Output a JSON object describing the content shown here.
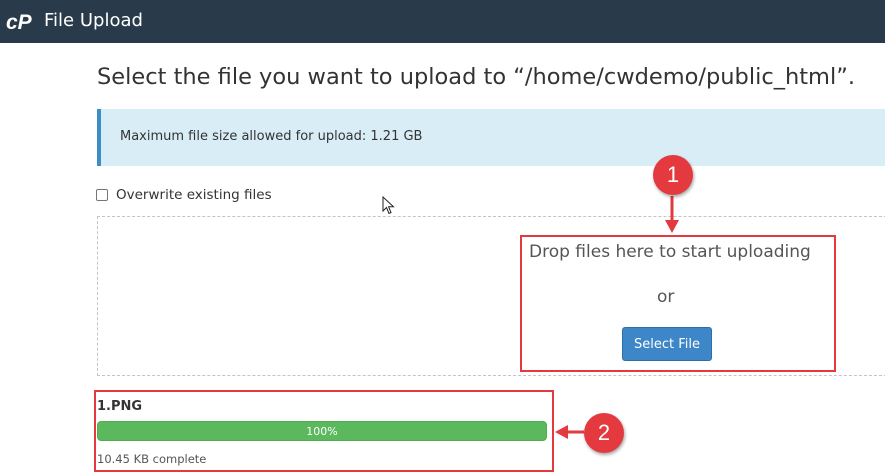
{
  "header": {
    "app_title": "File Upload",
    "logo": "cpanel-logo",
    "background_color": "#293a4a"
  },
  "main": {
    "heading": "Select the file you want to upload to “/home/cwdemo/public_html”.",
    "alert_text": "Maximum file size allowed for upload: 1.21 GB",
    "overwrite_label": "Overwrite existing files",
    "overwrite_checked": false,
    "drop_text": "Drop files here to start uploading",
    "or_text": "or",
    "select_button_label": "Select File"
  },
  "upload": {
    "file_name": "1.PNG",
    "progress_label": "100%",
    "progress_fraction": 1.0,
    "status_text": "10.45 KB complete",
    "progress_color": "#5cb85c"
  },
  "annotations": {
    "badge_1": "1",
    "badge_2": "2",
    "color": "#e3393f"
  }
}
